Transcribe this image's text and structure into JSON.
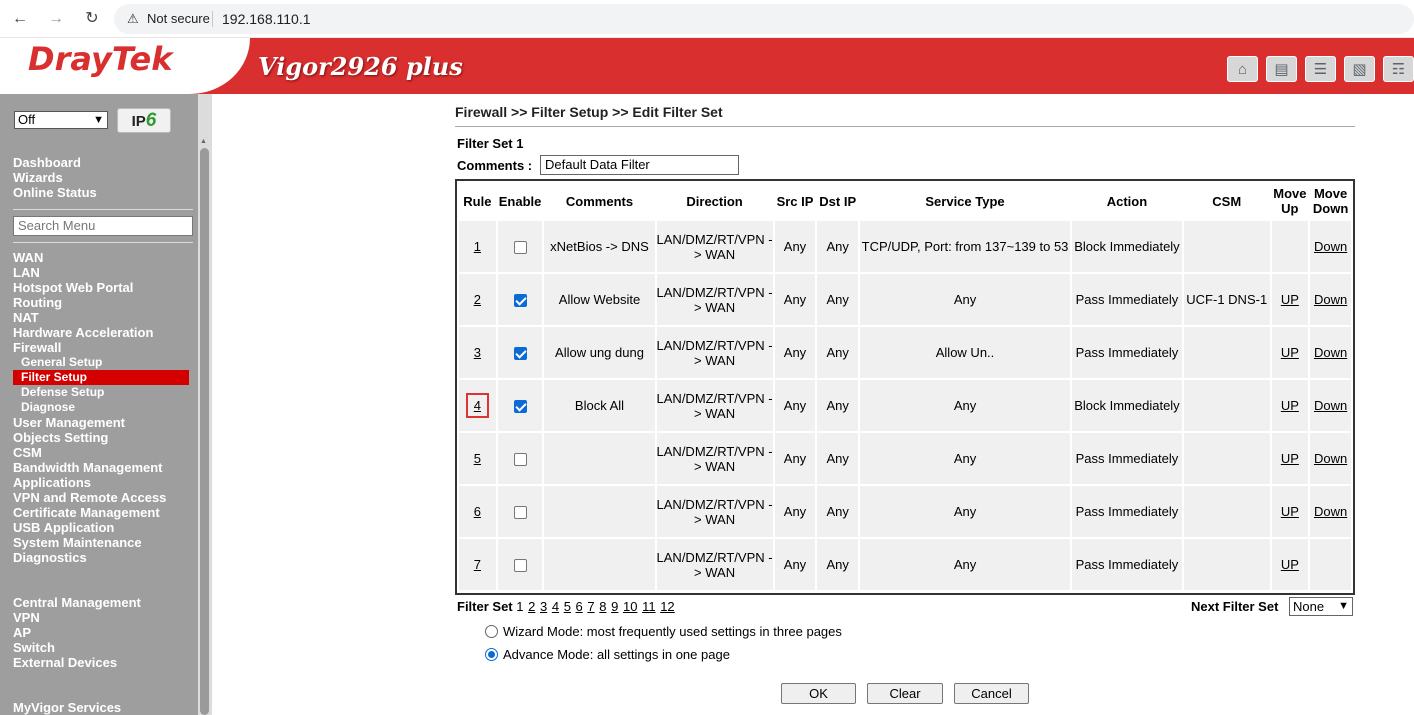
{
  "browser": {
    "not_secure": "Not secure",
    "url": "192.168.110.1"
  },
  "header": {
    "logo": "DrayTek",
    "model": "Vigor2926 plus",
    "icons": [
      "home-icon",
      "windows-icon",
      "sliders-icon",
      "save-icon",
      "book-icon"
    ]
  },
  "sidebar": {
    "mode_select": "Off",
    "ipv6_label_a": "IP",
    "ipv6_label_b": "6",
    "top_links": [
      "Dashboard",
      "Wizards",
      "Online Status"
    ],
    "search_placeholder": "Search Menu",
    "menu": [
      {
        "label": "WAN"
      },
      {
        "label": "LAN"
      },
      {
        "label": "Hotspot Web Portal"
      },
      {
        "label": "Routing"
      },
      {
        "label": "NAT"
      },
      {
        "label": "Hardware Acceleration"
      },
      {
        "label": "Firewall"
      },
      {
        "label": "General Setup",
        "sub": true
      },
      {
        "label": "Filter Setup",
        "sub": true,
        "active": true
      },
      {
        "label": "Defense Setup",
        "sub": true
      },
      {
        "label": "Diagnose",
        "sub": true
      },
      {
        "label": "User Management"
      },
      {
        "label": "Objects Setting"
      },
      {
        "label": "CSM"
      },
      {
        "label": "Bandwidth Management"
      },
      {
        "label": "Applications"
      },
      {
        "label": "VPN and Remote Access"
      },
      {
        "label": "Certificate Management"
      },
      {
        "label": "USB Application"
      },
      {
        "label": "System Maintenance"
      },
      {
        "label": "Diagnostics"
      }
    ],
    "central": [
      "Central Management",
      "VPN",
      "AP",
      "Switch",
      "External Devices"
    ],
    "myvigor": "MyVigor Services"
  },
  "main": {
    "breadcrumb": "Firewall >> Filter Setup >> Edit Filter Set",
    "set_title": "Filter Set 1",
    "comments_label": "Comments :",
    "comments_value": "Default Data Filter",
    "columns": [
      "Rule",
      "Enable",
      "Comments",
      "Direction",
      "Src IP",
      "Dst IP",
      "Service Type",
      "Action",
      "CSM",
      "Move Up",
      "Move Down"
    ],
    "rows": [
      {
        "rule": "1",
        "enabled": false,
        "comments": "xNetBios -> DNS",
        "direction": "LAN/DMZ/RT/VPN -> WAN",
        "src": "Any",
        "dst": "Any",
        "service": "TCP/UDP, Port: from 137~139 to 53",
        "action": "Block Immediately",
        "csm": "",
        "up": "",
        "down": "Down"
      },
      {
        "rule": "2",
        "enabled": true,
        "comments": "Allow Website",
        "direction": "LAN/DMZ/RT/VPN -> WAN",
        "src": "Any",
        "dst": "Any",
        "service": "Any",
        "action": "Pass Immediately",
        "csm": "UCF-1 DNS-1",
        "up": "UP",
        "down": "Down"
      },
      {
        "rule": "3",
        "enabled": true,
        "comments": "Allow ung dung",
        "direction": "LAN/DMZ/RT/VPN -> WAN",
        "src": "Any",
        "dst": "Any",
        "service": "Allow Un..",
        "action": "Pass Immediately",
        "csm": "",
        "up": "UP",
        "down": "Down"
      },
      {
        "rule": "4",
        "enabled": true,
        "comments": "Block All",
        "direction": "LAN/DMZ/RT/VPN -> WAN",
        "src": "Any",
        "dst": "Any",
        "service": "Any",
        "action": "Block Immediately",
        "csm": "",
        "up": "UP",
        "down": "Down",
        "highlight": true
      },
      {
        "rule": "5",
        "enabled": false,
        "comments": "",
        "direction": "LAN/DMZ/RT/VPN -> WAN",
        "src": "Any",
        "dst": "Any",
        "service": "Any",
        "action": "Pass Immediately",
        "csm": "",
        "up": "UP",
        "down": "Down"
      },
      {
        "rule": "6",
        "enabled": false,
        "comments": "",
        "direction": "LAN/DMZ/RT/VPN -> WAN",
        "src": "Any",
        "dst": "Any",
        "service": "Any",
        "action": "Pass Immediately",
        "csm": "",
        "up": "UP",
        "down": "Down"
      },
      {
        "rule": "7",
        "enabled": false,
        "comments": "",
        "direction": "LAN/DMZ/RT/VPN -> WAN",
        "src": "Any",
        "dst": "Any",
        "service": "Any",
        "action": "Pass Immediately",
        "csm": "",
        "up": "UP",
        "down": ""
      }
    ],
    "filter_set_label": "Filter Set",
    "filter_sets": [
      "1",
      "2",
      "3",
      "4",
      "5",
      "6",
      "7",
      "8",
      "9",
      "10",
      "11",
      "12"
    ],
    "current_set": "1",
    "next_set_label": "Next Filter Set",
    "next_set_value": "None",
    "wizard_mode": "Wizard Mode: most frequently used settings in three pages",
    "advance_mode": "Advance Mode: all settings in one page",
    "ok": "OK",
    "clear": "Clear",
    "cancel": "Cancel"
  },
  "colors": {
    "brand_red": "#d92f2f",
    "active_menu": "#d40000",
    "sidebar_bg": "#9e9e9e",
    "checkbox_blue": "#0b6ad6"
  }
}
